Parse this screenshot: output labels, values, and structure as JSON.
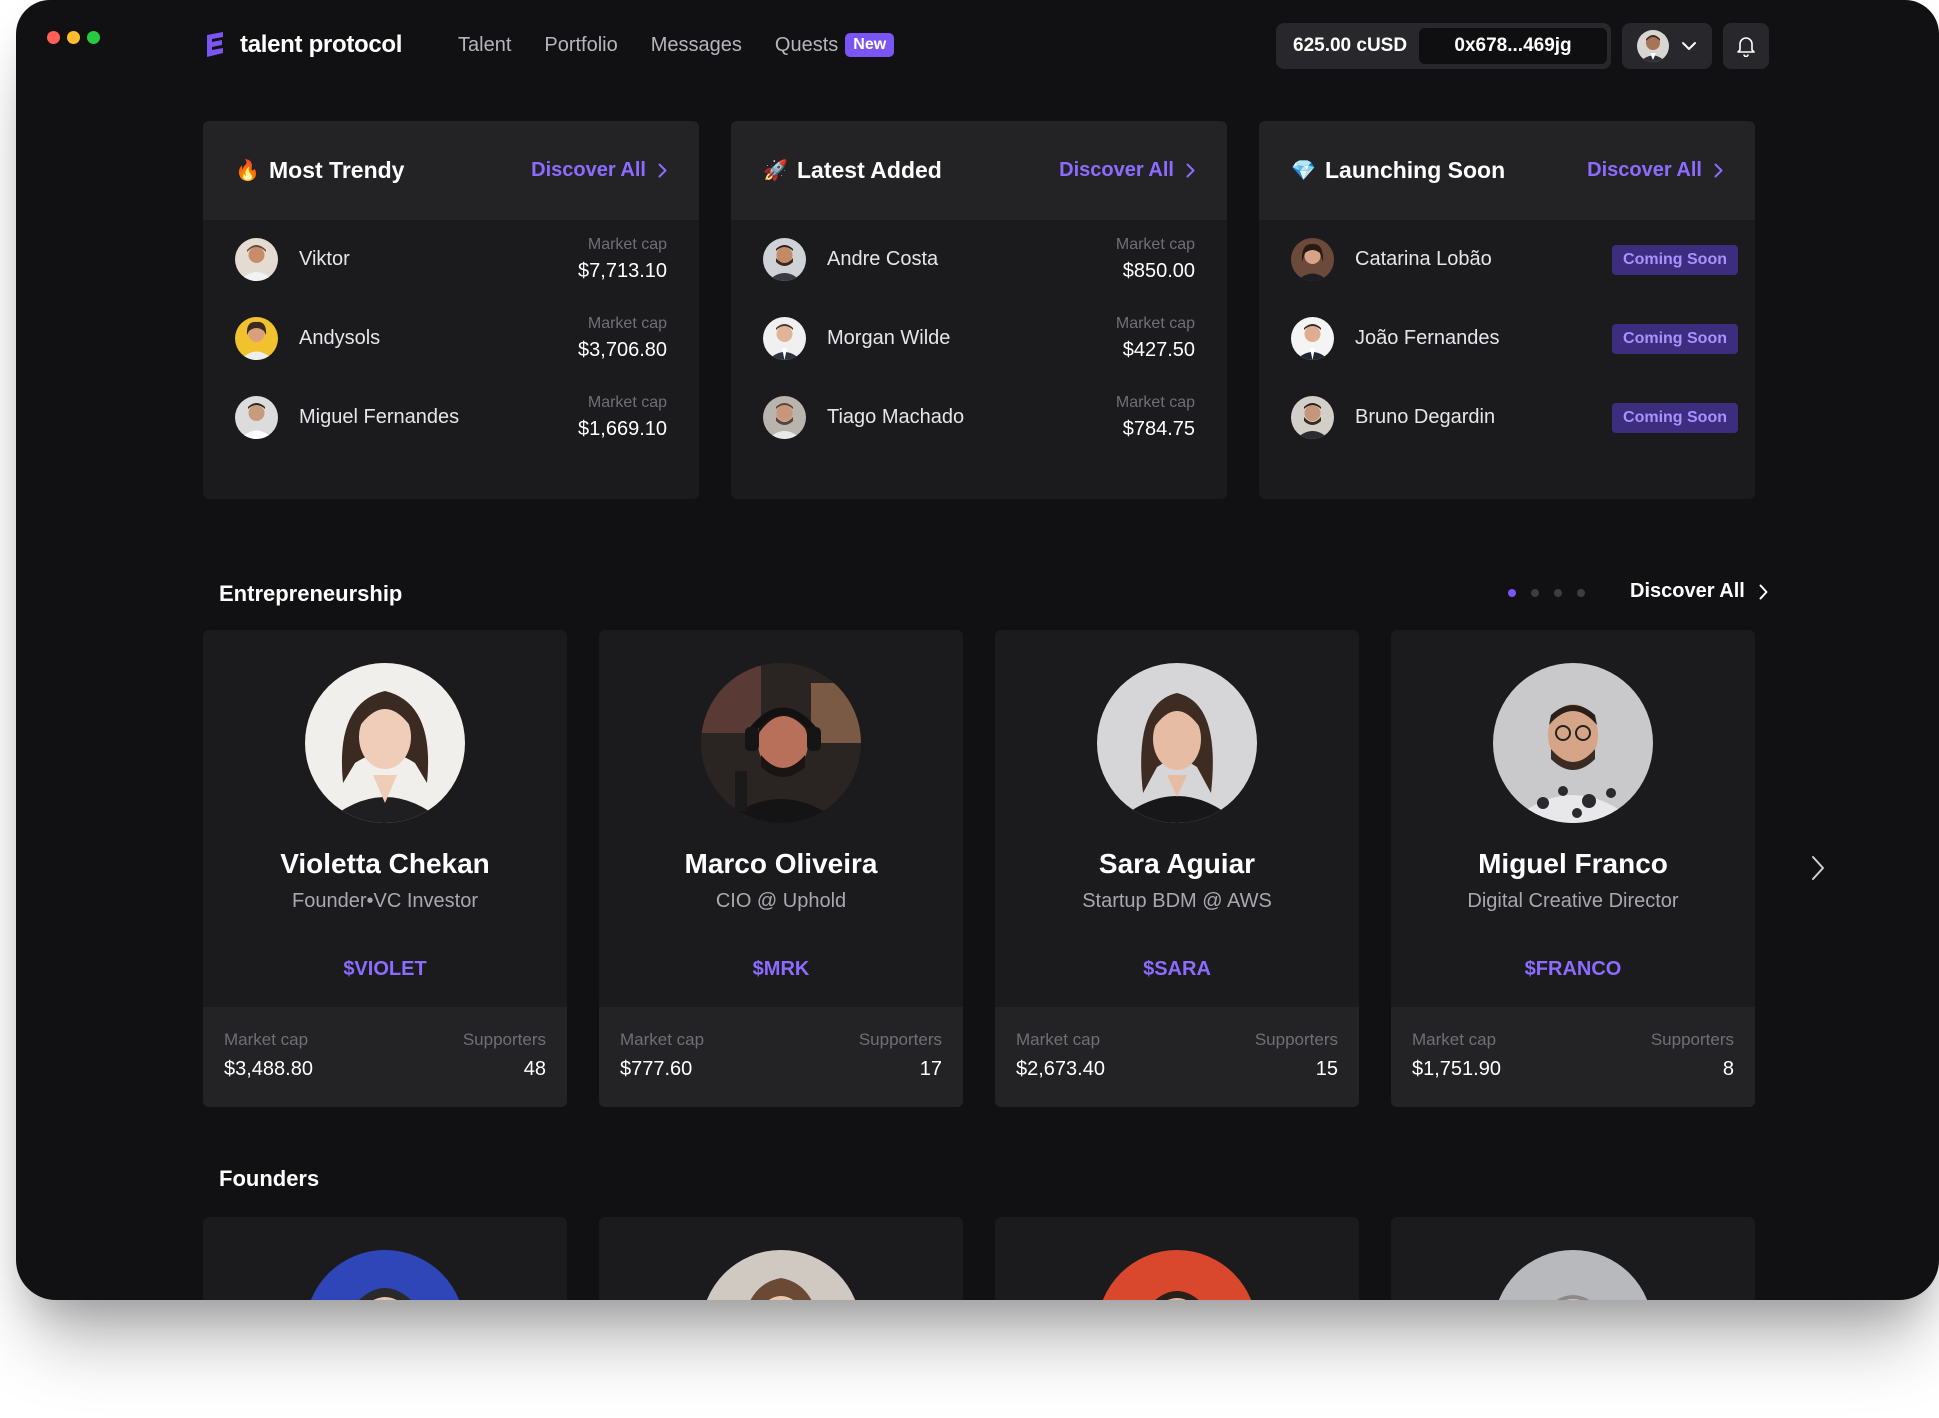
{
  "brand": {
    "name": "talent protocol"
  },
  "nav": [
    {
      "label": "Talent"
    },
    {
      "label": "Portfolio"
    },
    {
      "label": "Messages"
    },
    {
      "label": "Quests",
      "badge": "New"
    }
  ],
  "wallet": {
    "balance": "625.00 cUSD",
    "address": "0x678...469jg"
  },
  "panels": [
    {
      "emoji": "🔥",
      "title": "Most Trendy",
      "discover": "Discover All",
      "rows": [
        {
          "name": "Viktor",
          "label": "Market cap",
          "value": "$7,713.10"
        },
        {
          "name": "Andysols",
          "label": "Market cap",
          "value": "$3,706.80"
        },
        {
          "name": "Miguel Fernandes",
          "label": "Market cap",
          "value": "$1,669.10"
        }
      ]
    },
    {
      "emoji": "🚀",
      "title": "Latest Added",
      "discover": "Discover All",
      "rows": [
        {
          "name": "Andre Costa",
          "label": "Market cap",
          "value": "$850.00"
        },
        {
          "name": "Morgan Wilde",
          "label": "Market cap",
          "value": "$427.50"
        },
        {
          "name": "Tiago Machado",
          "label": "Market cap",
          "value": "$784.75"
        }
      ]
    },
    {
      "emoji": "💎",
      "title": "Launching Soon",
      "discover": "Discover All",
      "rows": [
        {
          "name": "Catarina Lobão",
          "status": "Coming Soon"
        },
        {
          "name": "João Fernandes",
          "status": "Coming Soon"
        },
        {
          "name": "Bruno Degardin",
          "status": "Coming Soon"
        }
      ]
    }
  ],
  "entrepreneurship": {
    "title": "Entrepreneurship",
    "discover": "Discover All",
    "cards": [
      {
        "name": "Violetta Chekan",
        "role": "Founder•VC Investor",
        "ticker": "$VIOLET",
        "mc_label": "Market cap",
        "mc": "$3,488.80",
        "sup_label": "Supporters",
        "supporters": "48"
      },
      {
        "name": "Marco Oliveira",
        "role": "CIO @ Uphold",
        "ticker": "$MRK",
        "mc_label": "Market cap",
        "mc": "$777.60",
        "sup_label": "Supporters",
        "supporters": "17"
      },
      {
        "name": "Sara Aguiar",
        "role": "Startup BDM @ AWS",
        "ticker": "$SARA",
        "mc_label": "Market cap",
        "mc": "$2,673.40",
        "sup_label": "Supporters",
        "supporters": "15"
      },
      {
        "name": "Miguel Franco",
        "role": "Digital Creative Director",
        "ticker": "$FRANCO",
        "mc_label": "Market cap",
        "mc": "$1,751.90",
        "sup_label": "Supporters",
        "supporters": "8"
      }
    ]
  },
  "founders": {
    "title": "Founders"
  },
  "colors": {
    "accent": "#7a55f4",
    "background": "#111113",
    "card": "#1b1b1e"
  }
}
